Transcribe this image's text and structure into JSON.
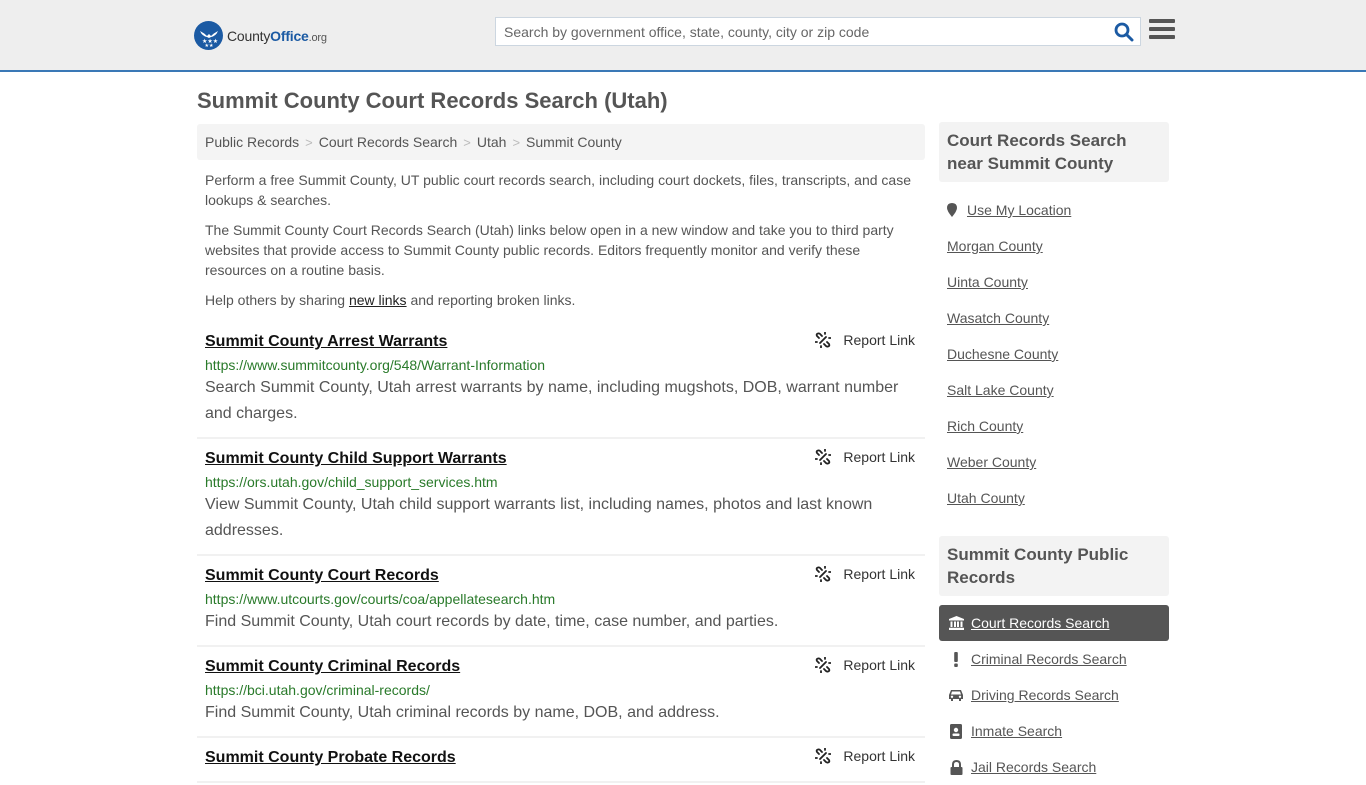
{
  "header": {
    "logo": {
      "brand_county": "County",
      "brand_office": "Office",
      "brand_tld": ".org"
    },
    "search": {
      "placeholder": "Search by government office, state, county, city or zip code",
      "value": ""
    },
    "search_icon": "search-icon",
    "menu_icon": "hamburger-menu-icon"
  },
  "page": {
    "title": "Summit County Court Records Search (Utah)"
  },
  "breadcrumb": [
    {
      "label": "Public Records"
    },
    {
      "label": "Court Records Search"
    },
    {
      "label": "Utah"
    },
    {
      "label": "Summit County"
    }
  ],
  "breadcrumb_separator": ">",
  "intro": {
    "p1": "Perform a free Summit County, UT public court records search, including court dockets, files, transcripts, and case lookups & searches.",
    "p2": "The Summit County Court Records Search (Utah) links below open in a new window and take you to third party websites that provide access to Summit County public records. Editors frequently monitor and verify these resources on a routine basis.",
    "p3_before": "Help others by sharing ",
    "p3_link": "new links",
    "p3_after": " and reporting broken links."
  },
  "results": [
    {
      "title": "Summit County Arrest Warrants",
      "url": "https://www.summitcounty.org/548/Warrant-Information",
      "description": "Search Summit County, Utah arrest warrants by name, including mugshots, DOB, warrant number and charges.",
      "report_label": "Report Link"
    },
    {
      "title": "Summit County Child Support Warrants",
      "url": "https://ors.utah.gov/child_support_services.htm",
      "description": "View Summit County, Utah child support warrants list, including names, photos and last known addresses.",
      "report_label": "Report Link"
    },
    {
      "title": "Summit County Court Records",
      "url": "https://www.utcourts.gov/courts/coa/appellatesearch.htm",
      "description": "Find Summit County, Utah court records by date, time, case number, and parties.",
      "report_label": "Report Link"
    },
    {
      "title": "Summit County Criminal Records",
      "url": "https://bci.utah.gov/criminal-records/",
      "description": "Find Summit County, Utah criminal records by name, DOB, and address.",
      "report_label": "Report Link"
    },
    {
      "title": "Summit County Probate Records",
      "url": "",
      "description": "",
      "report_label": "Report Link"
    }
  ],
  "sidebar": {
    "near": {
      "heading": "Court Records Search near Summit County",
      "use_location": "Use My Location",
      "items": [
        {
          "label": "Morgan County"
        },
        {
          "label": "Uinta County"
        },
        {
          "label": "Wasatch County"
        },
        {
          "label": "Duchesne County"
        },
        {
          "label": "Salt Lake County"
        },
        {
          "label": "Rich County"
        },
        {
          "label": "Weber County"
        },
        {
          "label": "Utah County"
        }
      ]
    },
    "public_records": {
      "heading": "Summit County Public Records",
      "items": [
        {
          "label": "Court Records Search",
          "icon": "courthouse-icon",
          "active": true
        },
        {
          "label": "Criminal Records Search",
          "icon": "exclamation-icon",
          "active": false
        },
        {
          "label": "Driving Records Search",
          "icon": "car-icon",
          "active": false
        },
        {
          "label": "Inmate Search",
          "icon": "id-badge-icon",
          "active": false
        },
        {
          "label": "Jail Records Search",
          "icon": "lock-icon",
          "active": false
        }
      ]
    }
  },
  "colors": {
    "header_bg": "#eeeeee",
    "header_border": "#3a78b6",
    "brand_blue": "#1b5aa3",
    "url_green": "#297a2a",
    "active_item_bg": "#555555"
  }
}
